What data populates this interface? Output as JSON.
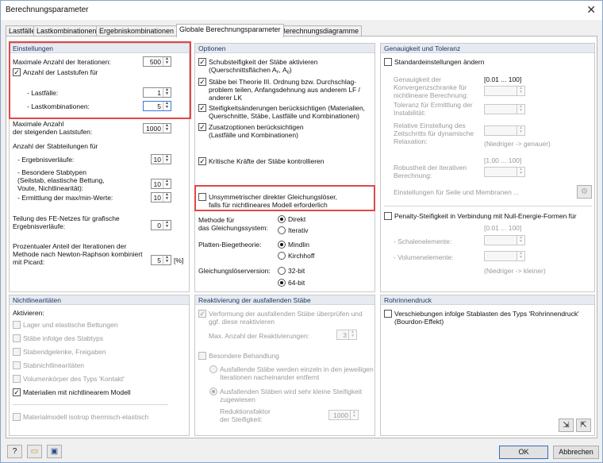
{
  "window": {
    "title": "Berechnungsparameter"
  },
  "tabs": [
    "Lastfälle",
    "Lastkombinationen",
    "Ergebniskombinationen",
    "Globale Berechnungsparameter",
    "Berechnungsdiagramme"
  ],
  "einstellungen": {
    "header": "Einstellungen",
    "max_iter_label": "Maximale Anzahl der Iterationen:",
    "max_iter_value": "500",
    "anzahl_laststufen_label": "Anzahl der Laststufen für",
    "lastfaelle_label": "- Lastfälle:",
    "lastfaelle_value": "1",
    "lastkomb_label": "- Lastkombinationen:",
    "lastkomb_value": "5",
    "max_steig_label": "Maximale Anzahl\nder steigenden Laststufen:",
    "max_steig_value": "1000",
    "stabteilungen_label": "Anzahl der Stabteilungen für",
    "ergebnisverlaeufe_label": "- Ergebnisverläufe:",
    "ergebnisverlaeufe_value": "10",
    "besondere_label": "- Besondere Stabtypen\n(Seilstab, elastische Bettung,\nVoute, Nichtlinearität):",
    "besondere_value": "10",
    "ermittlung_label": "- Ermittlung der max/min-Werte:",
    "ermittlung_value": "10",
    "fe_netz_label": "Teilung des FE-Netzes für grafische\nErgebnisverläufe:",
    "fe_netz_value": "0",
    "prozent_label": "Prozentualer Anteil der Iterationen der\nMethode nach Newton-Raphson kombiniert\nmit Picard:",
    "prozent_value": "5",
    "prozent_unit": "[%]"
  },
  "optionen": {
    "header": "Optionen",
    "opt1": "Schubsteifigkeit der Stäbe aktivieren\n(Querschnittsflächen Aᵧ, Aᵨ)",
    "opt2": "Stäbe bei Theorie III. Ordnung bzw. Durchschlag-\nproblem teilen, Anfangsdehnung aus anderem LF /\nanderer LK",
    "opt3": "Steifigkeitsänderungen berücksichtigen (Materialien,\nQuerschnitte, Stäbe, Lastfälle und Kombinationen)",
    "opt4": "Zusatzoptionen berücksichtigen\n(Lastfälle und Kombinationen)",
    "opt5": "Kritische Kräfte der Stäbe kontrollieren",
    "opt6": "Unsymmetrischer direkter Gleichungslöser,\nfalls für nichtlineares Modell erforderlich",
    "methode_label": "Methode für\ndas Gleichungssystem:",
    "direkt": "Direkt",
    "iterativ": "Iterativ",
    "platten_label": "Platten-Biegetheorie:",
    "mindlin": "Mindlin",
    "kirchhoff": "Kirchhoff",
    "loeser_label": "Gleichungslöserversion:",
    "bit32": "32-bit",
    "bit64": "64-bit"
  },
  "genauigkeit": {
    "header": "Genauigkeit und Toleranz",
    "standard": "Standardeinstellungen ändern",
    "konv_label": "Genauigkeit der\nKonvergenzschranke für\nnichtlineare Berechnung:",
    "range1": "[0.01 ... 100]",
    "toleranz_label": "Toleranz für Ermittlung der\nInstabilität:",
    "relativ_label": "Relative Einstellung des\nZeitschritts für dynamische\nRelaxation:",
    "hint1": "(Niedriger -> genauer)",
    "range2": "[1.00 ... 100]",
    "robust_label": "Robustheit der iterativen\nBerechnung:",
    "seile_label": "Einstellungen für Seile und Membranen ...",
    "penalty": "Penalty-Steifigkeit in Verbindung mit Null-Energie-Formen für",
    "range3": "[0.01 ... 100]",
    "schalen_label": "- Schalenelemente:",
    "volumen_label": "- Volumenelemente:",
    "hint2": "(Niedriger -> kleiner)"
  },
  "nichtlinear": {
    "header": "Nichtlinearitäten",
    "aktivieren": "Aktivieren:",
    "items": [
      "Lager und elastische Bettungen",
      "Stäbe infolge des Stabtyps",
      "Stabendgelenke, Freigaben",
      "Stabnichtlinearitäten",
      "Volumenkörper des Typs 'Kontakt'",
      "Materialien mit nichtlinearem Modell"
    ],
    "isotrop": "Materialmodell isotrop thermisch-elastisch"
  },
  "reaktivierung": {
    "header": "Reaktivierung der ausfallenden Stäbe",
    "verformung": "Verformung der ausfallenden Stäbe überprüfen und\nggf. diese reaktivieren",
    "max_label": "Max. Anzahl der Reaktivierungen:",
    "max_value": "3",
    "besondere": "Besondere Behandlung",
    "r1": "Ausfallende Stäbe werden einzeln in den jeweiligen\nIterationen nacheinander entfernt",
    "r2": "Ausfallenden Stäben wird sehr kleine Steifigkeit\nzugewiesen",
    "reduktion_label": "Reduktionsfaktor\nder Steifigkeit:",
    "reduktion_value": "1000"
  },
  "rohrinnendruck": {
    "header": "Rohrinnendruck",
    "verschiebung": "Verschiebungen infolge Stablasten des Typs 'Rohrinnendruck'\n(Bourdon-Effekt)"
  },
  "footer": {
    "ok": "OK",
    "abbrechen": "Abbrechen"
  }
}
